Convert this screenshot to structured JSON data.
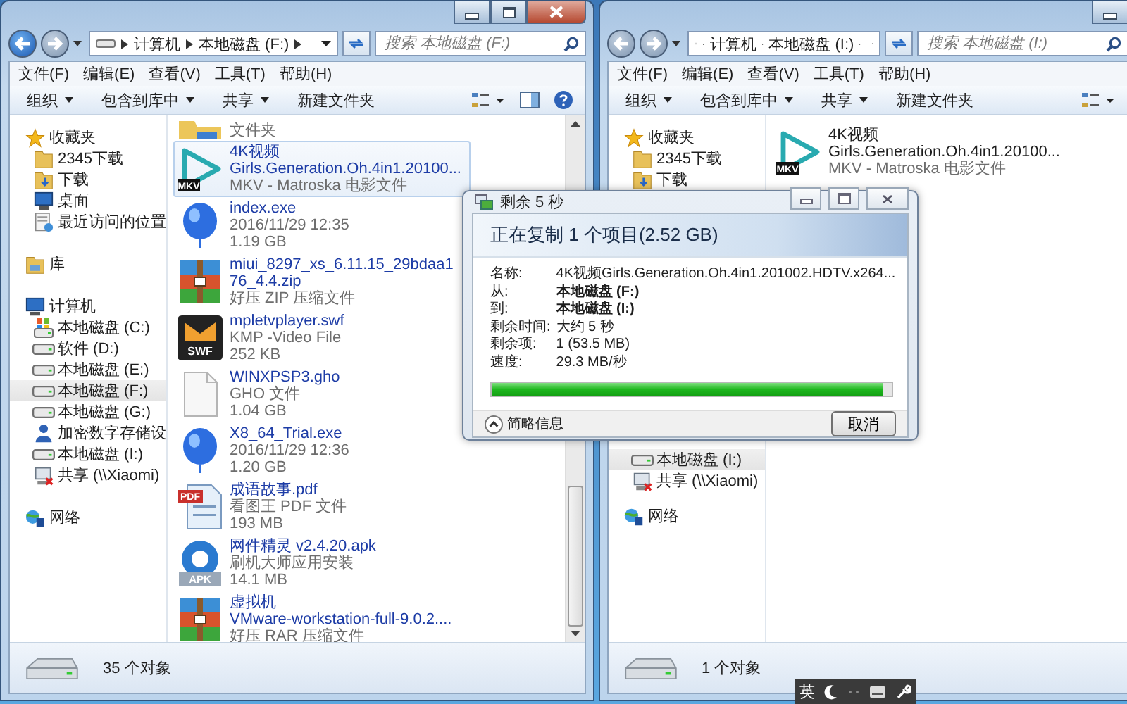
{
  "windows": [
    {
      "address": [
        "计算机",
        "本地磁盘 (F:)"
      ],
      "search": {
        "placeholder": "搜索 本地磁盘 (F:)"
      },
      "menu": [
        "文件(F)",
        "编辑(E)",
        "查看(V)",
        "工具(T)",
        "帮助(H)"
      ],
      "toolbar": [
        {
          "label": "组织",
          "dropdown": true
        },
        {
          "label": "包含到库中",
          "dropdown": true
        },
        {
          "label": "共享",
          "dropdown": true
        },
        {
          "label": "新建文件夹",
          "dropdown": false
        }
      ],
      "sidebar": [
        {
          "kind": "tree",
          "nodes": [
            {
              "label": "收藏夹",
              "kind": "star",
              "selected": false,
              "children": [
                {
                  "label": "2345下载",
                  "kind": "folder",
                  "selected": false
                },
                {
                  "label": "下载",
                  "kind": "download",
                  "selected": false
                },
                {
                  "label": "桌面",
                  "kind": "desktop",
                  "selected": false
                },
                {
                  "label": "最近访问的位置",
                  "kind": "recent",
                  "selected": false
                }
              ]
            }
          ]
        },
        {
          "kind": "tree",
          "nodes": [
            {
              "label": "库",
              "kind": "library",
              "selected": false
            }
          ]
        },
        {
          "kind": "tree",
          "nodes": [
            {
              "label": "计算机",
              "kind": "computer",
              "selected": false,
              "children": [
                {
                  "label": "本地磁盘 (C:)",
                  "kind": "drive-sys",
                  "selected": false
                },
                {
                  "label": "软件 (D:)",
                  "kind": "drive",
                  "selected": false
                },
                {
                  "label": "本地磁盘 (E:)",
                  "kind": "drive",
                  "selected": false
                },
                {
                  "label": "本地磁盘 (F:)",
                  "kind": "drive",
                  "selected": true
                },
                {
                  "label": "本地磁盘 (G:)",
                  "kind": "drive",
                  "selected": false
                },
                {
                  "label": "加密数字存储设",
                  "kind": "encrypted",
                  "selected": false
                },
                {
                  "label": "本地磁盘 (I:)",
                  "kind": "drive",
                  "selected": false
                },
                {
                  "label": "共享 (\\\\Xiaomi)",
                  "kind": "share",
                  "selected": false
                }
              ]
            }
          ]
        },
        {
          "kind": "tree",
          "nodes": [
            {
              "label": "网络",
              "kind": "network",
              "selected": false
            }
          ]
        }
      ],
      "files": [
        {
          "kind": "folder",
          "selected": false,
          "partial": true,
          "details": [
            "文件夹"
          ]
        },
        {
          "kind": "mkv",
          "badge": "MKV",
          "selected": true,
          "partial": false,
          "name": [
            "4K视频",
            "Girls.Generation.Oh.4in1.20100..."
          ],
          "details": [
            "MKV - Matroska 电影文件"
          ]
        },
        {
          "kind": "balloon",
          "selected": false,
          "partial": false,
          "name": [
            "index.exe"
          ],
          "details": [
            "2016/11/29 12:35",
            "1.19 GB"
          ]
        },
        {
          "kind": "archive",
          "selected": false,
          "partial": false,
          "name": [
            "miui_8297_xs_6.11.15_29bdaa1",
            "76_4.4.zip"
          ],
          "details": [
            "好压 ZIP 压缩文件"
          ]
        },
        {
          "kind": "swf",
          "badge": "SWF",
          "selected": false,
          "partial": false,
          "name": [
            "mpletvplayer.swf"
          ],
          "details": [
            "KMP -Video File",
            "252 KB"
          ]
        },
        {
          "kind": "doc",
          "selected": false,
          "partial": false,
          "name": [
            "WINXPSP3.gho"
          ],
          "details": [
            "GHO 文件",
            "1.04 GB"
          ]
        },
        {
          "kind": "balloon",
          "selected": false,
          "partial": false,
          "name": [
            "X8_64_Trial.exe"
          ],
          "details": [
            "2016/11/29 12:36",
            "1.20 GB"
          ]
        },
        {
          "kind": "pdf",
          "badge": "PDF",
          "selected": false,
          "partial": false,
          "name": [
            "成语故事.pdf"
          ],
          "details": [
            "看图王 PDF 文件",
            "193 MB"
          ]
        },
        {
          "kind": "apk",
          "badge": "APK",
          "selected": false,
          "partial": false,
          "name": [
            "网件精灵 v2.4.20.apk"
          ],
          "details": [
            "刷机大师应用安装",
            "14.1 MB"
          ]
        },
        {
          "kind": "archive",
          "selected": false,
          "partial": false,
          "name": [
            "虚拟机",
            "VMware-workstation-full-9.0.2...."
          ],
          "details": [
            "好压 RAR 压缩文件"
          ]
        }
      ],
      "status": "35 个对象"
    },
    {
      "address": [
        "计算机",
        "本地磁盘 (I:)"
      ],
      "search": {
        "placeholder": "搜索 本地磁盘 (I:)"
      },
      "menu": [
        "文件(F)",
        "编辑(E)",
        "查看(V)",
        "工具(T)",
        "帮助(H)"
      ],
      "toolbar": [
        {
          "label": "组织",
          "dropdown": true
        },
        {
          "label": "包含到库中",
          "dropdown": true
        },
        {
          "label": "共享",
          "dropdown": true
        },
        {
          "label": "新建文件夹",
          "dropdown": false
        }
      ],
      "sidebar": [
        {
          "kind": "tree",
          "nodes": [
            {
              "label": "收藏夹",
              "kind": "star",
              "selected": false,
              "children": [
                {
                  "label": "2345下载",
                  "kind": "folder",
                  "selected": false
                },
                {
                  "label": "下载",
                  "kind": "download",
                  "selected": false
                }
              ]
            }
          ]
        },
        {
          "kind": "continued",
          "nodes": [
            {
              "label": "本地磁盘 (I:)",
              "kind": "drive",
              "selected": true
            },
            {
              "label": "共享 (\\\\Xiaomi)",
              "kind": "share",
              "selected": false
            }
          ]
        },
        {
          "kind": "tree",
          "nodes": [
            {
              "label": "网络",
              "kind": "network",
              "selected": false
            }
          ]
        }
      ],
      "files": [
        {
          "kind": "mkv",
          "badge": "MKV",
          "selected": false,
          "partial": false,
          "name": [
            "4K视频",
            "Girls.Generation.Oh.4in1.20100..."
          ],
          "details": [
            "MKV - Matroska 电影文件"
          ]
        }
      ],
      "status": "1 个对象"
    }
  ],
  "dialog": {
    "title": "剩余 5 秒",
    "heading": "正在复制 1 个项目(2.52 GB)",
    "rows": [
      {
        "label": "名称:",
        "value": "4K视频Girls.Generation.Oh.4in1.201002.HDTV.x264...",
        "bold": false
      },
      {
        "label": "从:",
        "value": "本地磁盘 (F:)",
        "bold": true
      },
      {
        "label": "到:",
        "value": "本地磁盘 (I:)",
        "bold": true
      },
      {
        "label": "剩余时间:",
        "value": "大约 5 秒",
        "bold": false
      },
      {
        "label": "剩余项:",
        "value": "1 (53.5 MB)",
        "bold": false
      },
      {
        "label": "速度:",
        "value": "29.3 MB/秒",
        "bold": false
      }
    ],
    "progress": {
      "level": 0.98
    },
    "details_toggle": "简略信息",
    "cancel": "取消"
  },
  "ime_bar": {
    "label": "英"
  }
}
